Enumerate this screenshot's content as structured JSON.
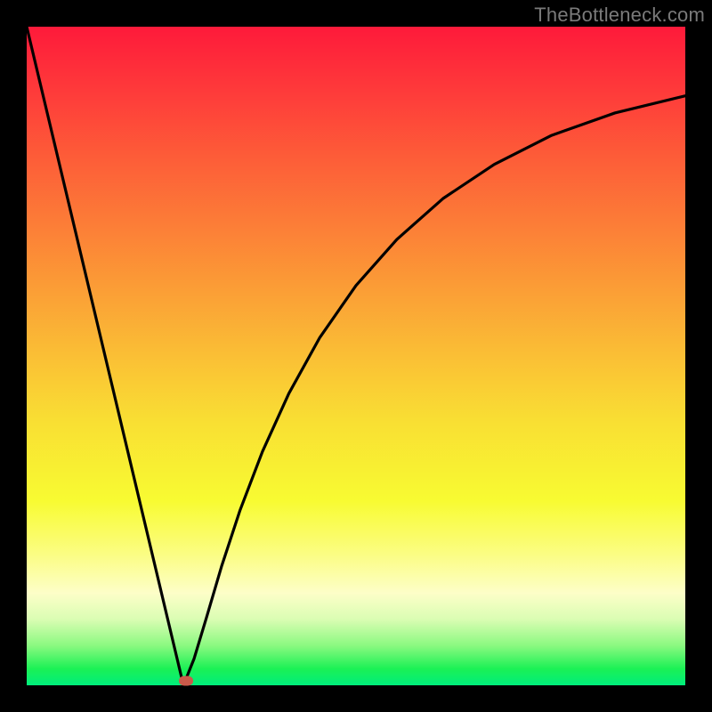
{
  "watermark": "TheBottleneck.com",
  "chart_data": {
    "type": "line",
    "title": "",
    "xlabel": "",
    "ylabel": "",
    "xlim": [
      0,
      1
    ],
    "ylim": [
      0,
      1
    ],
    "grid": false,
    "legend": false,
    "series": [
      {
        "name": "left-line",
        "x": [
          0.0,
          0.238
        ],
        "y": [
          1.0,
          0.0
        ]
      },
      {
        "name": "right-curve",
        "x": [
          0.238,
          0.254,
          0.273,
          0.296,
          0.324,
          0.358,
          0.398,
          0.445,
          0.5,
          0.562,
          0.632,
          0.71,
          0.797,
          0.893,
          1.0
        ],
        "y": [
          0.0,
          0.04,
          0.103,
          0.181,
          0.266,
          0.355,
          0.443,
          0.528,
          0.607,
          0.677,
          0.739,
          0.791,
          0.835,
          0.869,
          0.895
        ]
      }
    ],
    "marker": {
      "x": 0.242,
      "y": 0.007,
      "color": "#ca5a4a"
    },
    "background_gradient": {
      "top": "#fe1a3a",
      "middle": "#f9df33",
      "bottom": "#00ed7c"
    }
  }
}
